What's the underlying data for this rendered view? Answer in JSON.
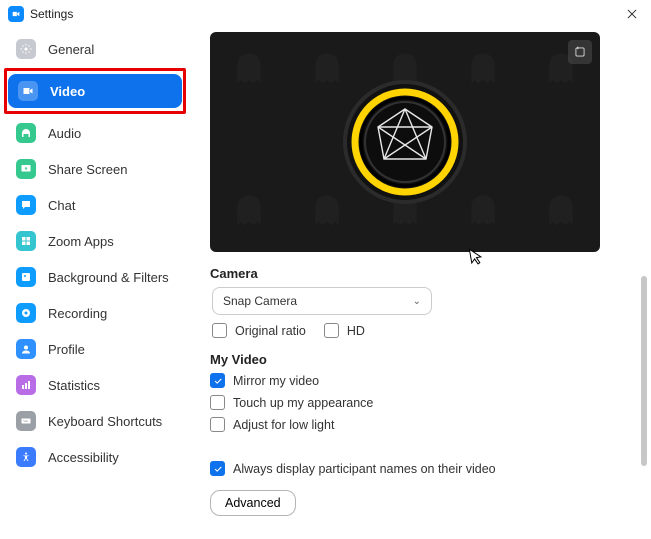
{
  "window": {
    "title": "Settings"
  },
  "sidebar": {
    "items": [
      {
        "label": "General",
        "icon": "gear",
        "color": "#bfc3c8"
      },
      {
        "label": "Video",
        "icon": "video",
        "color": "#ffffff",
        "active": true
      },
      {
        "label": "Audio",
        "icon": "headphones",
        "color": "#36c98f"
      },
      {
        "label": "Share Screen",
        "icon": "share",
        "color": "#36c98f"
      },
      {
        "label": "Chat",
        "icon": "chat",
        "color": "#0e9cff"
      },
      {
        "label": "Zoom Apps",
        "icon": "apps",
        "color": "#34c5d0"
      },
      {
        "label": "Background & Filters",
        "icon": "filters",
        "color": "#0e9cff"
      },
      {
        "label": "Recording",
        "icon": "record",
        "color": "#0e9cff"
      },
      {
        "label": "Profile",
        "icon": "profile",
        "color": "#2f91ff"
      },
      {
        "label": "Statistics",
        "icon": "stats",
        "color": "#b86ce6"
      },
      {
        "label": "Keyboard Shortcuts",
        "icon": "keyboard",
        "color": "#9aa0a6"
      },
      {
        "label": "Accessibility",
        "icon": "accessibility",
        "color": "#3b7cff"
      }
    ]
  },
  "camera": {
    "section_label": "Camera",
    "selected": "Snap Camera",
    "original_ratio_label": "Original ratio",
    "hd_label": "HD",
    "original_ratio": false,
    "hd": false
  },
  "myvideo": {
    "section_label": "My Video",
    "mirror_label": "Mirror my video",
    "touchup_label": "Touch up my appearance",
    "lowlight_label": "Adjust for low light",
    "mirror": true,
    "touchup": false,
    "lowlight": false
  },
  "other": {
    "names_label": "Always display participant names on their video",
    "names": true
  },
  "buttons": {
    "advanced": "Advanced"
  }
}
